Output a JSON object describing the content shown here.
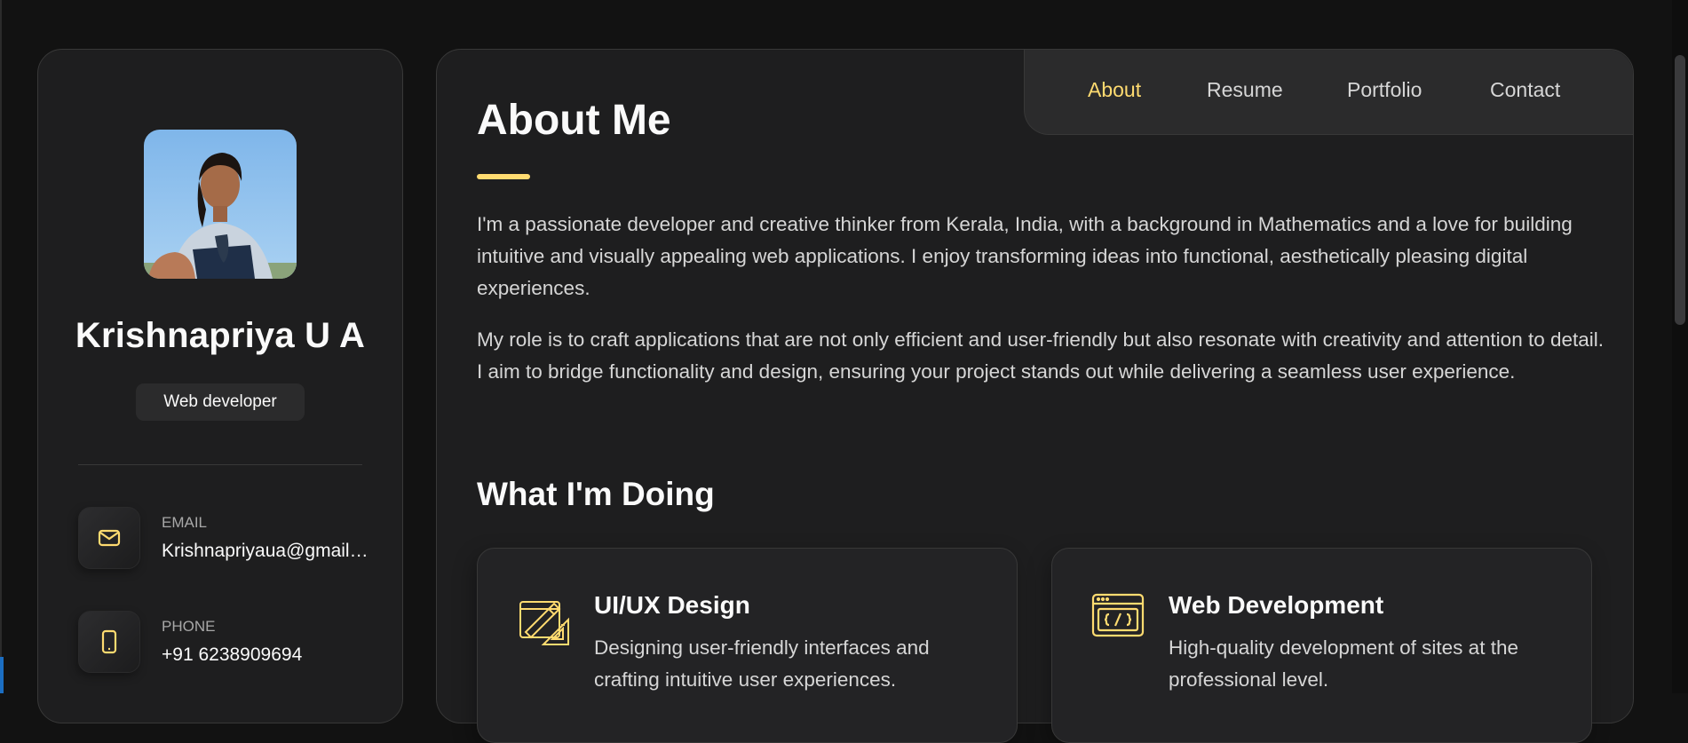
{
  "profile": {
    "name": "Krishnapriya U A",
    "role": "Web developer"
  },
  "contacts": [
    {
      "title": "Email",
      "value": "Krishnapriyaua@gmail.com",
      "icon": "mail-icon"
    },
    {
      "title": "Phone",
      "value": "+91 6238909694",
      "icon": "phone-icon"
    }
  ],
  "nav": {
    "items": [
      "About",
      "Resume",
      "Portfolio",
      "Contact"
    ],
    "active": "About"
  },
  "about": {
    "title": "About Me",
    "paragraphs": [
      "I'm a passionate developer and creative thinker from Kerala, India, with a background in Mathematics and a love for building intuitive and visually appealing web applications. I enjoy transforming ideas into functional, aesthetically pleasing digital experiences.",
      "My role is to craft applications that are not only efficient and user-friendly but also resonate with creativity and attention to detail. I aim to bridge functionality and design, ensuring your project stands out while delivering a seamless user experience."
    ]
  },
  "services": {
    "title": "What I'm Doing",
    "items": [
      {
        "title": "UI/UX Design",
        "text": "Designing user-friendly interfaces and crafting intuitive user experiences.",
        "icon": "design-icon"
      },
      {
        "title": "Web Development",
        "text": "High-quality development of sites at the professional level.",
        "icon": "code-window-icon"
      }
    ]
  },
  "colors": {
    "accent": "#ffdb70",
    "background": "#121212",
    "card": "#1e1e1f",
    "text": "#fafafa",
    "muted": "#d6d6d6"
  }
}
